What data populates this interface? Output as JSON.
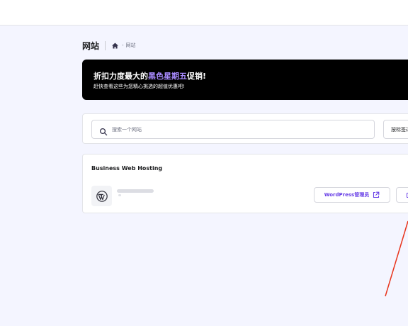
{
  "header": {
    "title": "网站",
    "breadcrumb": {
      "separator": "-",
      "current": "网站"
    }
  },
  "promo": {
    "title_prefix": "折扣力度最大的",
    "title_highlight": "黑色星期五",
    "title_suffix": "促销!",
    "subtitle": "赶快查看这些为您精心挑选的超值优惠吧!",
    "highlight_color": "#a98bff"
  },
  "search": {
    "placeholder": "搜索一个网站",
    "filter_label": "按标签过"
  },
  "hosting": {
    "plan_title": "Business Web Hosting",
    "wp_admin_label": "WordPress管理员",
    "site_logo_icon": "wordpress-icon",
    "accent_color": "#673de6"
  }
}
